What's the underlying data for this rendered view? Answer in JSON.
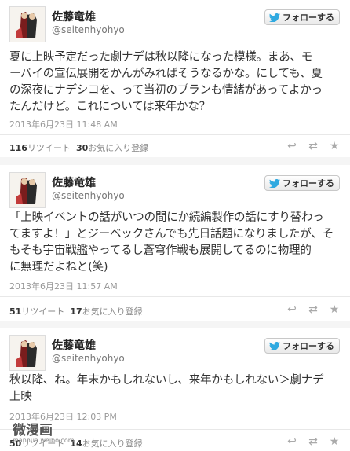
{
  "follow_label": "フォローする",
  "tweets": [
    {
      "name": "佐藤竜雄",
      "handle": "@seitenhyohyo",
      "text": "夏に上映予定だった劇ナデは秋以降になった模様。まあ、モ\nーバイの宣伝展開をかんがみればそうなるかな。にしても、夏\nの深夜にナデシコを、って当初のプランも情緒があってよかっ\nたんだけど。これについては来年かな？",
      "time": "2013年6月23日  11:48 AM",
      "retweets": "116",
      "retweets_label": "リツイート",
      "favorites": "30",
      "favorites_label": "お気に入り登録"
    },
    {
      "name": "佐藤竜雄",
      "handle": "@seitenhyohyo",
      "text": "「上映イベントの話がいつの間にか続編製作の話にすり替わっ\nてますよ！」とジーベックさんでも先日話題になりましたが、そ\nもそも宇宙戦艦やってるし蒼穹作戦も展開してるのに物理的\nに無理だよねと(笑)",
      "time": "2013年6月23日  11:57 AM",
      "retweets": "51",
      "retweets_label": "リツイート",
      "favorites": "17",
      "favorites_label": "お気に入り登録"
    },
    {
      "name": "佐藤竜雄",
      "handle": "@seitenhyohyo",
      "text": "秋以降、ね。年末かもしれないし、来年かもしれない＞劇ナデ\n上映",
      "time": "2013年6月23日  12:03 PM",
      "retweets": "50",
      "retweets_label": "リツイート",
      "favorites": "14",
      "favorites_label": "お気に入り登録"
    }
  ],
  "watermark": {
    "main": "微漫画",
    "sub": "manhua.weibo.com"
  },
  "icons": {
    "reply": "reply-icon",
    "retweet": "retweet-icon",
    "favorite": "star-icon",
    "bird": "twitter-bird-icon"
  },
  "colors": {
    "bird": "#2fa9e0",
    "text": "#333333",
    "meta": "#999999"
  }
}
